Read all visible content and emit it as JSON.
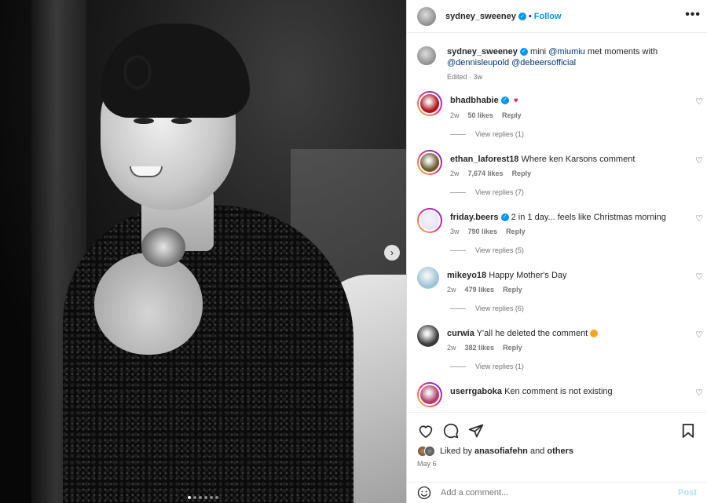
{
  "post": {
    "author": "sydney_sweeney",
    "follow_label": "Follow",
    "more_label": "•••",
    "caption": {
      "username": "sydney_sweeney",
      "text_before": "mini ",
      "mention_1": "@miumiu",
      "text_middle": " met moments with",
      "mention_2": "@dennisleupold",
      "mention_3": "@debeersofficial",
      "meta": "Edited · 3w"
    },
    "photo": {
      "slide_count": 6,
      "active_slide": 1,
      "next_label": "›"
    }
  },
  "comments": [
    {
      "username": "bhadbhabie",
      "verified": true,
      "text": "",
      "emoji": "heart-eyes",
      "age": "2w",
      "likes": "50 likes",
      "reply_label": "Reply",
      "replies_label": "View replies (1)",
      "story_ring": true
    },
    {
      "username": "ethan_laforest18",
      "verified": false,
      "text": "Where ken Karsons comment",
      "age": "2w",
      "likes": "7,674 likes",
      "reply_label": "Reply",
      "replies_label": "View replies (7)",
      "story_ring": true
    },
    {
      "username": "friday.beers",
      "verified": true,
      "text": "2 in 1 day... feels like Christmas morning",
      "age": "3w",
      "likes": "790 likes",
      "reply_label": "Reply",
      "replies_label": "View replies (5)",
      "story_ring": true
    },
    {
      "username": "mikeyo18",
      "verified": false,
      "text": "Happy Mother's Day",
      "age": "2w",
      "likes": "479 likes",
      "reply_label": "Reply",
      "replies_label": "View replies (6)",
      "story_ring": false
    },
    {
      "username": "curwia",
      "verified": false,
      "text": "Y'all he deleted the comment",
      "emoji": "laughing-face",
      "age": "2w",
      "likes": "382 likes",
      "reply_label": "Reply",
      "replies_label": "View replies (1)",
      "story_ring": false
    },
    {
      "username": "userrgaboka",
      "verified": false,
      "text": "Ken comment is not existing",
      "story_ring": true
    }
  ],
  "footer": {
    "liked_by_prefix": "Liked by",
    "liked_by_user": "anasofiafehn",
    "liked_by_and": "and",
    "liked_by_others": "others",
    "date": "May 6",
    "comment_placeholder": "Add a comment...",
    "post_label": "Post"
  },
  "colors": {
    "link": "#0095f6",
    "mention": "#00376b",
    "muted": "#737373",
    "text": "#262626"
  }
}
